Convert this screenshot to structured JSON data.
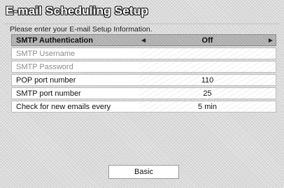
{
  "window": {
    "title": "E-mail Scheduling Setup",
    "instruction": "Please enter your E-mail Setup Information."
  },
  "settings": [
    {
      "label": "SMTP Authentication",
      "value": "Off",
      "state": "selected"
    },
    {
      "label": "SMTP Username",
      "value": "",
      "state": "disabled"
    },
    {
      "label": "SMTP Password",
      "value": "",
      "state": "disabled"
    },
    {
      "label": "POP port number",
      "value": "110",
      "state": "normal"
    },
    {
      "label": "SMTP port number",
      "value": "25",
      "state": "normal"
    },
    {
      "label": "Check for new emails every",
      "value": "5 min",
      "state": "normal"
    }
  ],
  "icons": {
    "left_arrow": "left-arrow-icon",
    "right_arrow": "right-arrow-icon"
  },
  "footer": {
    "basic_button_label": "Basic"
  }
}
